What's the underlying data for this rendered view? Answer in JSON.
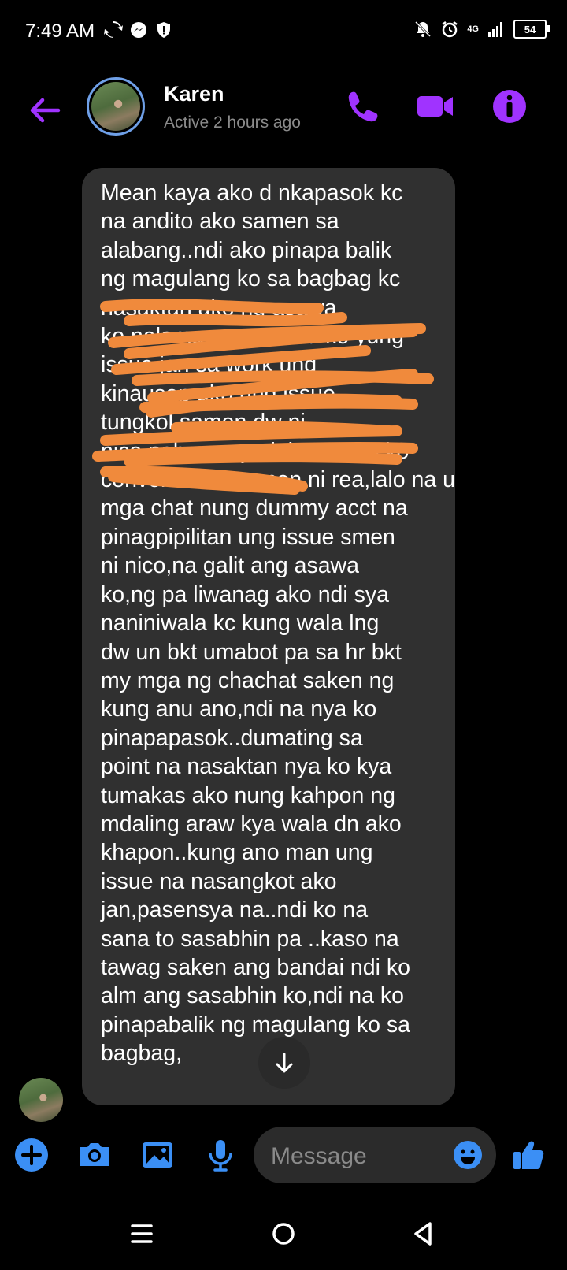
{
  "status_bar": {
    "time": "7:49 AM",
    "network": "4G",
    "battery": "54",
    "icons_left": [
      "sync-icon",
      "messenger-icon",
      "shield-icon"
    ],
    "icons_right": [
      "mute-icon",
      "alarm-icon",
      "signal-icon",
      "battery-icon"
    ]
  },
  "header": {
    "name": "Karen",
    "status": "Active 2 hours ago",
    "accent_color": "#a033ff"
  },
  "message": {
    "lines": [
      "Mean kaya ako d nkapasok kc",
      "na andito ako samen sa",
      "alabang..ndi ako pinapa balik",
      "ng magulang ko sa bagbag kc",
      "nasaktan ako ng asawa",
      "ko nalaman ng asawa ko yung",
      "issue jan sa work ung",
      "kinausap ako ung issue",
      "tungkol samen dw ni",
      "nico nabasa nya lahat sa cp ko",
      "conversation samen ni rea,lalo na ung",
      "mga chat nung dummy acct na",
      "pinagpipilitan ung issue smen",
      "ni nico,na galit ang asawa",
      "ko,ng pa liwanag ako ndi sya",
      "naniniwala kc kung wala lng",
      "dw un bkt umabot pa sa hr bkt",
      "my mga ng chachat saken ng",
      "kung anu ano,ndi na nya ko",
      "pinapapasok..dumating sa",
      "point na nasaktan nya ko kya",
      "tumakas ako nung kahpon ng",
      "mdaling araw kya wala dn ako",
      "khapon..kung ano man ung",
      "issue na nasangkot ako",
      "jan,pasensya na..ndi ko na",
      "sana to sasabhin pa ..kaso na",
      "tawag saken ang bandai ndi ko",
      "alm ang sasabhin ko,ndi na ko",
      "pinapabalik ng magulang ko sa",
      "bagbag,"
    ],
    "bubble_color": "#303030",
    "scribble_color": "#f08a3c"
  },
  "composer": {
    "placeholder": "Message",
    "icon_color": "#3b8ff5"
  },
  "nav": {
    "buttons": [
      "recents-icon",
      "home-icon",
      "back-icon"
    ]
  }
}
